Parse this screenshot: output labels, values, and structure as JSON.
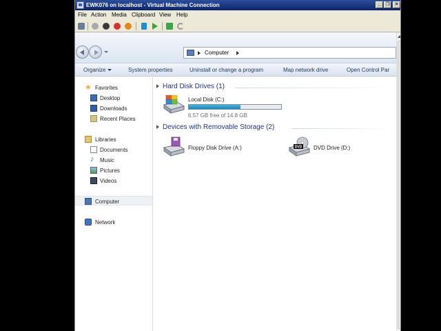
{
  "window": {
    "title": "EWK076 on localhost - Virtual Machine Connection",
    "controls": {
      "minimize": "_",
      "restore": "❐",
      "close": "✕"
    }
  },
  "menu": [
    "File",
    "Action",
    "Media",
    "Clipboard",
    "View",
    "Help"
  ],
  "vm_toolbar": [
    {
      "name": "ctrl-alt-del-icon",
      "color": "#6b7c95"
    },
    {
      "name": "start-icon",
      "color": "#a9a9a9"
    },
    {
      "name": "turn-off-icon",
      "color": "#3a3a3a"
    },
    {
      "name": "shutdown-icon",
      "color": "#d9322c"
    },
    {
      "name": "save-icon",
      "color": "#e08a1c"
    },
    {
      "name": "pause-icon",
      "color": "#1f8dd6"
    },
    {
      "name": "resume-icon",
      "color": "#3ba53b"
    },
    {
      "name": "snapshot-icon",
      "color": "#3aa648"
    },
    {
      "name": "revert-icon",
      "color": "#9a9a9a"
    }
  ],
  "address": {
    "location": "Computer"
  },
  "command_bar": {
    "organize": "Organize",
    "system_properties": "System properties",
    "uninstall": "Uninstall or change a program",
    "map_drive": "Map network drive",
    "control_panel": "Open Control Par"
  },
  "nav": {
    "favorites": "Favorites",
    "desktop": "Desktop",
    "downloads": "Downloads",
    "recent": "Recent Places",
    "libraries": "Libraries",
    "documents": "Documents",
    "music": "Music",
    "pictures": "Pictures",
    "videos": "Videos",
    "computer": "Computer",
    "network": "Network"
  },
  "content": {
    "hdd_group": "Hard Disk Drives (1)",
    "removable_group": "Devices with Removable Storage (2)",
    "local_disk": {
      "name": "Local Disk (C:)",
      "free_text": "6.57 GB free of 14.8 GB",
      "used_fraction": 0.556
    },
    "floppy": "Floppy Disk Drive (A:)",
    "dvd": "DVD Drive (D:)",
    "dvd_badge": "DVD"
  },
  "colors": {
    "title_bar": "#0a246a",
    "accent_text": "#1e3287",
    "progress": "#1b87c3"
  }
}
